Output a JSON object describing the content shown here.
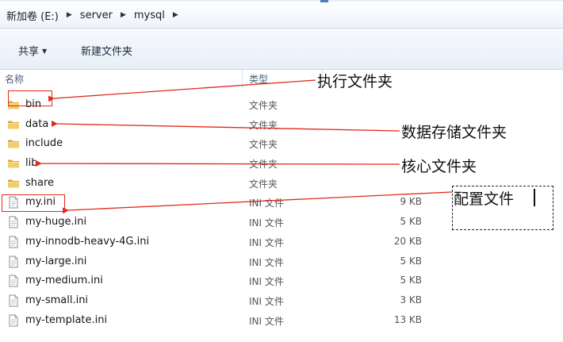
{
  "breadcrumb": [
    "新加卷 (E:)",
    "server",
    "mysql"
  ],
  "toolbar": {
    "share_label": "共享",
    "new_folder_label": "新建文件夹"
  },
  "columns": {
    "name": "名称",
    "type": "类型"
  },
  "files": [
    {
      "name": "bin",
      "type": "文件夹",
      "size": "",
      "icon": "folder-icon"
    },
    {
      "name": "data",
      "type": "文件夹",
      "size": "",
      "icon": "folder-icon"
    },
    {
      "name": "include",
      "type": "文件夹",
      "size": "",
      "icon": "folder-icon"
    },
    {
      "name": "lib",
      "type": "文件夹",
      "size": "",
      "icon": "folder-icon"
    },
    {
      "name": "share",
      "type": "文件夹",
      "size": "",
      "icon": "folder-icon"
    },
    {
      "name": "my.ini",
      "type": "INI 文件",
      "size": "9 KB",
      "icon": "ini-file-icon"
    },
    {
      "name": "my-huge.ini",
      "type": "INI 文件",
      "size": "5 KB",
      "icon": "ini-file-icon"
    },
    {
      "name": "my-innodb-heavy-4G.ini",
      "type": "INI 文件",
      "size": "20 KB",
      "icon": "ini-file-icon"
    },
    {
      "name": "my-large.ini",
      "type": "INI 文件",
      "size": "5 KB",
      "icon": "ini-file-icon"
    },
    {
      "name": "my-medium.ini",
      "type": "INI 文件",
      "size": "5 KB",
      "icon": "ini-file-icon"
    },
    {
      "name": "my-small.ini",
      "type": "INI 文件",
      "size": "3 KB",
      "icon": "ini-file-icon"
    },
    {
      "name": "my-template.ini",
      "type": "INI 文件",
      "size": "13 KB",
      "icon": "ini-file-icon"
    }
  ],
  "annotations": {
    "bin": "执行文件夹",
    "data": "数据存储文件夹",
    "lib": "核心文件夹",
    "config": "配置文件"
  },
  "colors": {
    "annotation_red": "#e02a1c",
    "folder_yellow": "#e8b84a"
  }
}
